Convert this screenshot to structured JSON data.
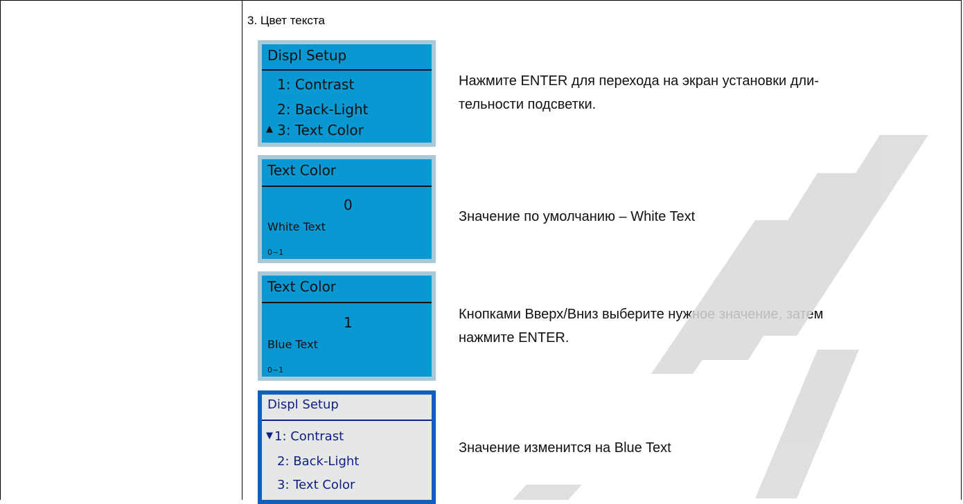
{
  "section": {
    "title": "3. Цвет текста"
  },
  "screens": [
    {
      "title": "Displ Setup",
      "items": [
        "1: Contrast",
        "2: Back-Light",
        "3: Text Color"
      ],
      "cursor_glyph": "▲",
      "description_lines": [
        "Нажмите ENTER для перехода на экран установки дли-",
        "тельности подсветки."
      ]
    },
    {
      "title": "Text Color",
      "value": "0",
      "value_label": "White Text",
      "range": "0~1",
      "description_lines": [
        "Значение по умолчанию – White Text"
      ]
    },
    {
      "title": "Text Color",
      "value": "1",
      "value_label": "Blue Text",
      "range": "0~1",
      "description_lines": [
        "Кнопками Вверх/Вниз выберите нужное значение, затем",
        "нажмите ENTER."
      ]
    },
    {
      "title": "Displ Setup",
      "items": [
        "1: Contrast",
        "2: Back-Light",
        "3: Text Color"
      ],
      "cursor_glyph": "▼",
      "description_lines": [
        "Значение изменится на Blue Text"
      ]
    }
  ],
  "colors": {
    "lcd_blue_bg": "#0a98d2",
    "lcd_blue_frame": "#a9c8d8",
    "lcd_light_bg": "#e6e8e7",
    "lcd_light_frame": "#1060c0",
    "lcd_light_text": "#102080"
  },
  "watermark_icon": "diagonal-watermark-stripes"
}
